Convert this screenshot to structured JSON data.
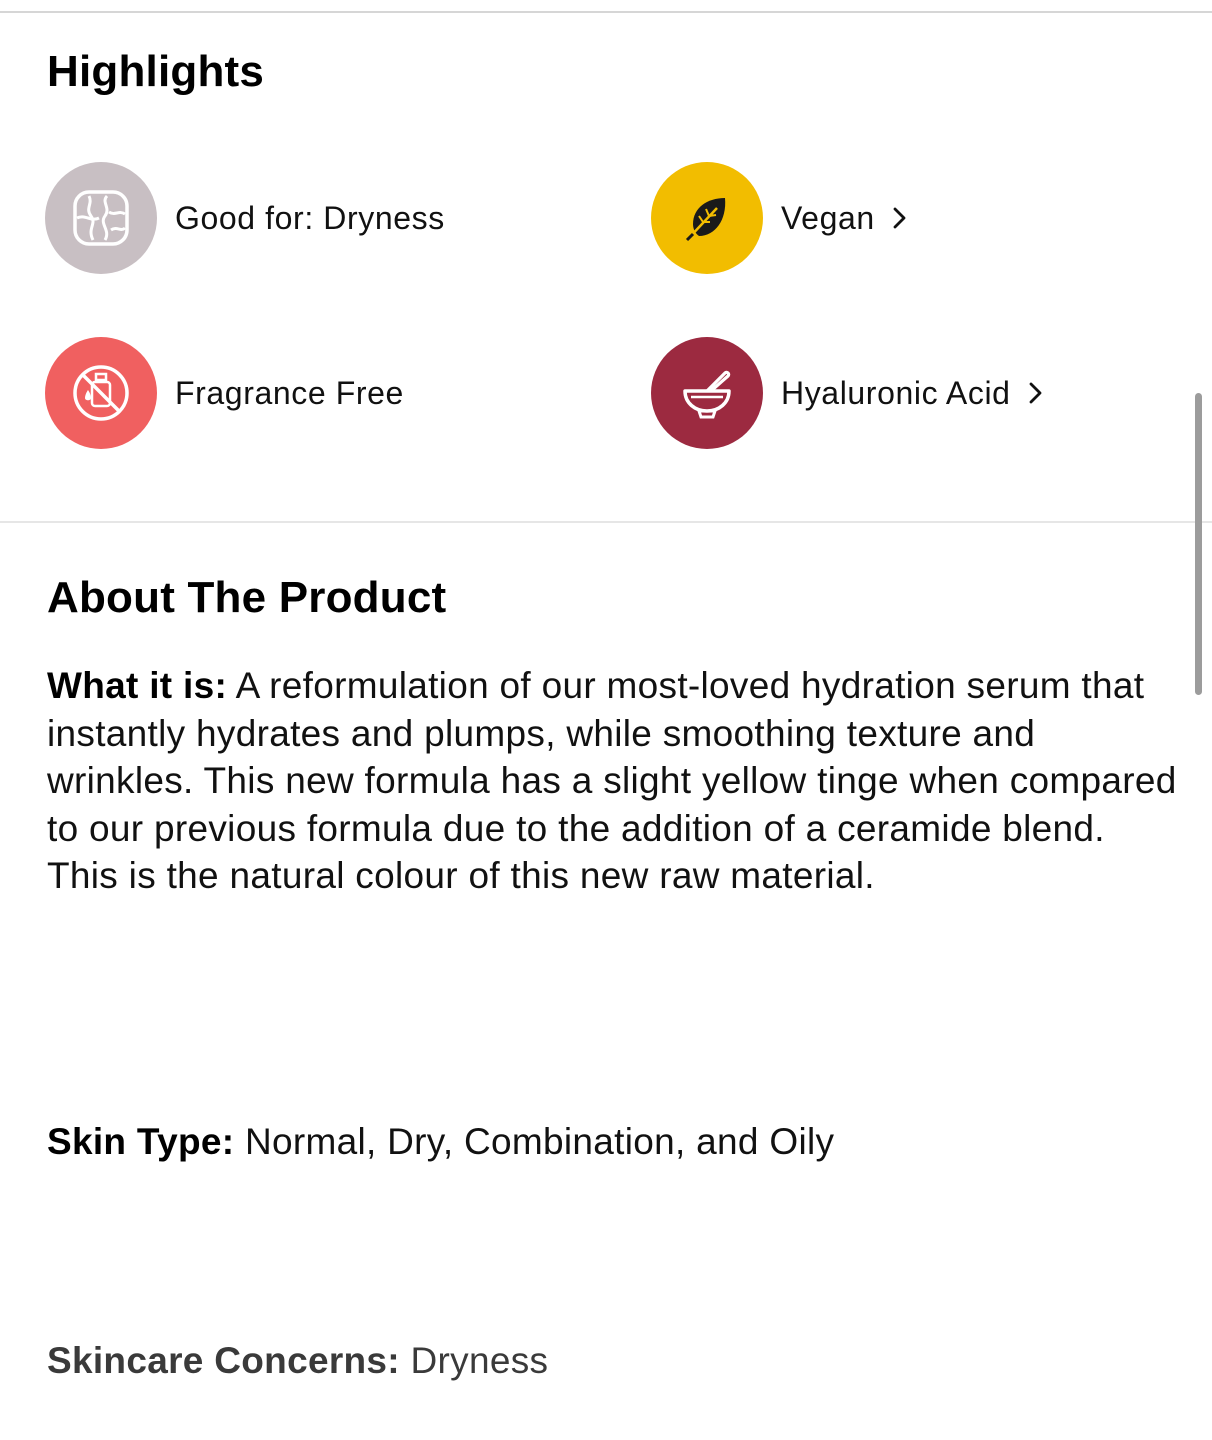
{
  "highlights": {
    "title": "Highlights",
    "items": [
      {
        "label": "Good for: Dryness",
        "icon": "skin-texture-icon",
        "color": "#c8bfc3",
        "has_chevron": false
      },
      {
        "label": "Vegan",
        "icon": "leaf-icon",
        "color": "#f2bd00",
        "has_chevron": true
      },
      {
        "label": "Fragrance Free",
        "icon": "no-fragrance-icon",
        "color": "#f06060",
        "has_chevron": false
      },
      {
        "label": "Hyaluronic Acid",
        "icon": "mortar-pestle-icon",
        "color": "#9c2a40",
        "has_chevron": true
      }
    ]
  },
  "about": {
    "title": "About The Product",
    "what_it_is_label": "What it is:",
    "what_it_is_text": " A reformulation of our most-loved hydration serum that instantly hydrates and plumps, while smoothing texture and wrinkles. This new formula has a slight yellow tinge when compared to our previous formula due to the addition of a ceramide blend. This is the natural colour of this new raw material.",
    "skin_type_label": "Skin Type:",
    "skin_type_text": " Normal, Dry, Combination, and Oily",
    "concerns_label": "Skincare Concerns:",
    "concerns_text": " Dryness"
  }
}
